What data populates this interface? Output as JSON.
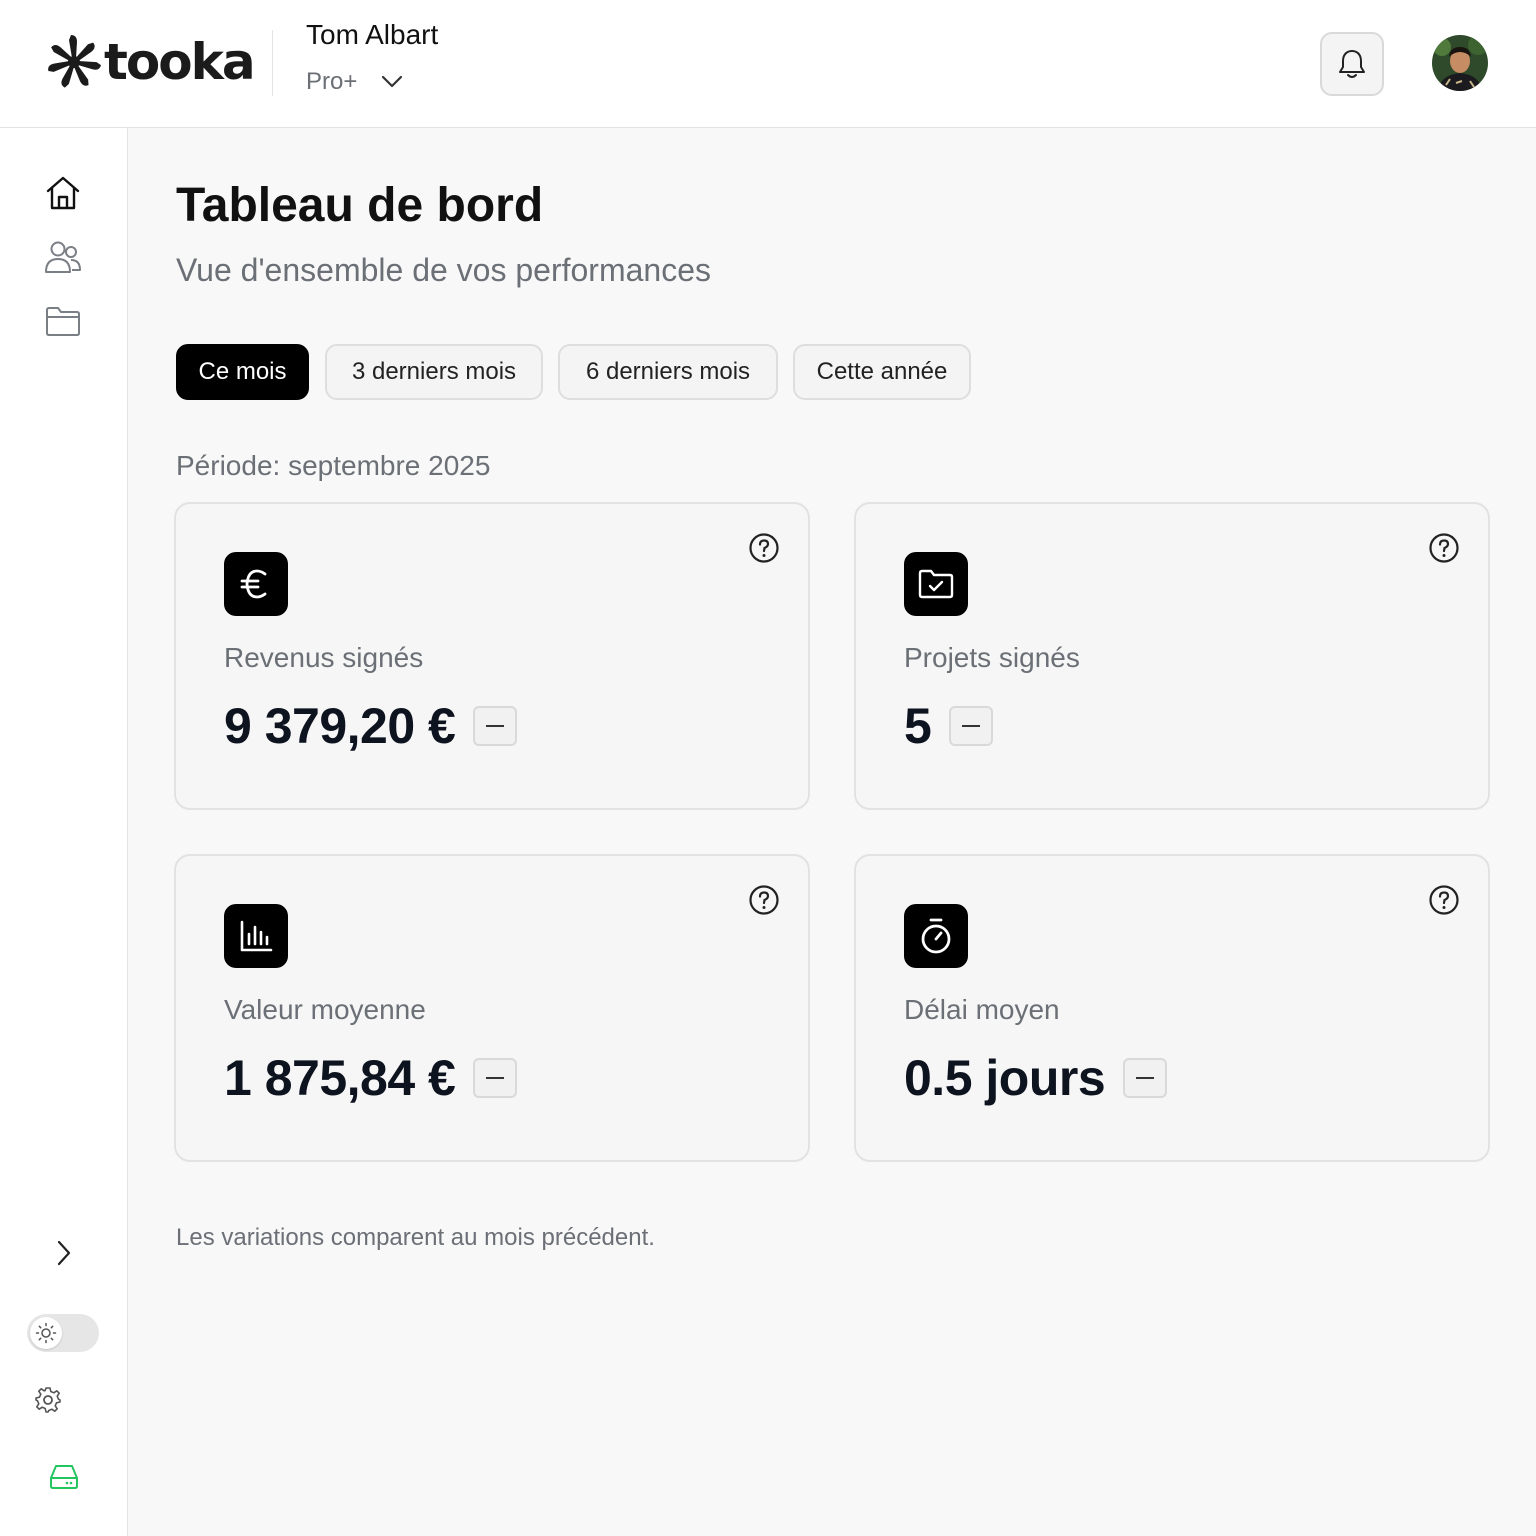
{
  "brand": {
    "name": "tooka"
  },
  "user": {
    "name": "Tom Albart",
    "plan": "Pro+"
  },
  "header": {
    "notifications_icon": "bell-icon"
  },
  "sidebar": {
    "items": [
      {
        "id": "home",
        "icon": "home-icon"
      },
      {
        "id": "clients",
        "icon": "users-icon"
      },
      {
        "id": "projects",
        "icon": "folder-icon"
      }
    ],
    "bottom": [
      {
        "id": "expand",
        "icon": "chevron-right-icon"
      },
      {
        "id": "theme",
        "icon": "sun-icon"
      },
      {
        "id": "settings",
        "icon": "gear-icon"
      },
      {
        "id": "storage",
        "icon": "drive-icon"
      }
    ]
  },
  "dashboard": {
    "title": "Tableau de bord",
    "subtitle": "Vue d'ensemble de vos performances",
    "filters": [
      {
        "label": "Ce mois",
        "active": true
      },
      {
        "label": "3 derniers mois",
        "active": false
      },
      {
        "label": "6 derniers mois",
        "active": false
      },
      {
        "label": "Cette année",
        "active": false
      }
    ],
    "period": "Période: septembre 2025",
    "cards": [
      {
        "label": "Revenus signés",
        "value": "9 379,20 €",
        "icon": "euro-icon"
      },
      {
        "label": "Projets signés",
        "value": "5",
        "icon": "folder-check-icon"
      },
      {
        "label": "Valeur moyenne",
        "value": "1 875,84 €",
        "icon": "bar-chart-icon"
      },
      {
        "label": "Délai moyen",
        "value": "0.5 jours",
        "icon": "stopwatch-icon"
      }
    ],
    "footnote": "Les variations comparent au mois précédent."
  },
  "colors": {
    "accent": "#000000",
    "muted_text": "#6b6f76",
    "storage_icon": "#22c55e"
  }
}
